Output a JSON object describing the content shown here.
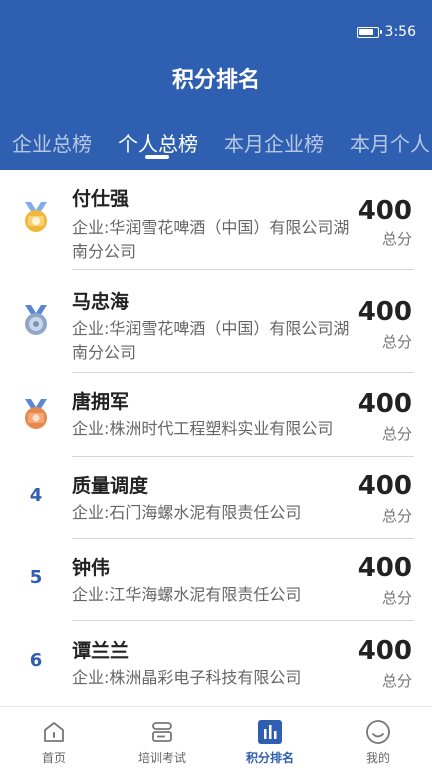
{
  "status_bar": {
    "time": "3:56"
  },
  "header": {
    "title": "积分排名"
  },
  "tabs": [
    {
      "label": "企业总榜"
    },
    {
      "label": "个人总榜"
    },
    {
      "label": "本月企业榜"
    },
    {
      "label": "本月个人"
    }
  ],
  "ranking": [
    {
      "rank": "",
      "name": "付仕强",
      "company": "企业:华润雪花啤酒（中国）有限公司湖南分公司",
      "score": "400",
      "score_label": "总分",
      "medal": "gold"
    },
    {
      "rank": "",
      "name": "马忠海",
      "company": "企业:华润雪花啤酒（中国）有限公司湖南分公司",
      "score": "400",
      "score_label": "总分",
      "medal": "silver"
    },
    {
      "rank": "",
      "name": "唐拥军",
      "company": "企业:株洲时代工程塑料实业有限公司",
      "score": "400",
      "score_label": "总分",
      "medal": "bronze"
    },
    {
      "rank": "4",
      "name": "质量调度",
      "company": "企业:石门海螺水泥有限责任公司",
      "score": "400",
      "score_label": "总分"
    },
    {
      "rank": "5",
      "name": "钟伟",
      "company": "企业:江华海螺水泥有限责任公司",
      "score": "400",
      "score_label": "总分"
    },
    {
      "rank": "6",
      "name": "谭兰兰",
      "company": "企业:株洲晶彩电子科技有限公司",
      "score": "400",
      "score_label": "总分"
    }
  ],
  "bottom_nav": [
    {
      "label": "首页",
      "icon": "home-icon"
    },
    {
      "label": "培训考试",
      "icon": "exam-icon"
    },
    {
      "label": "积分排名",
      "icon": "ranking-icon"
    },
    {
      "label": "我的",
      "icon": "profile-icon"
    }
  ],
  "colors": {
    "primary": "#2f5fb0",
    "gold": "#f0b73a",
    "silver": "#8fa7c4",
    "bronze": "#e6874b"
  }
}
